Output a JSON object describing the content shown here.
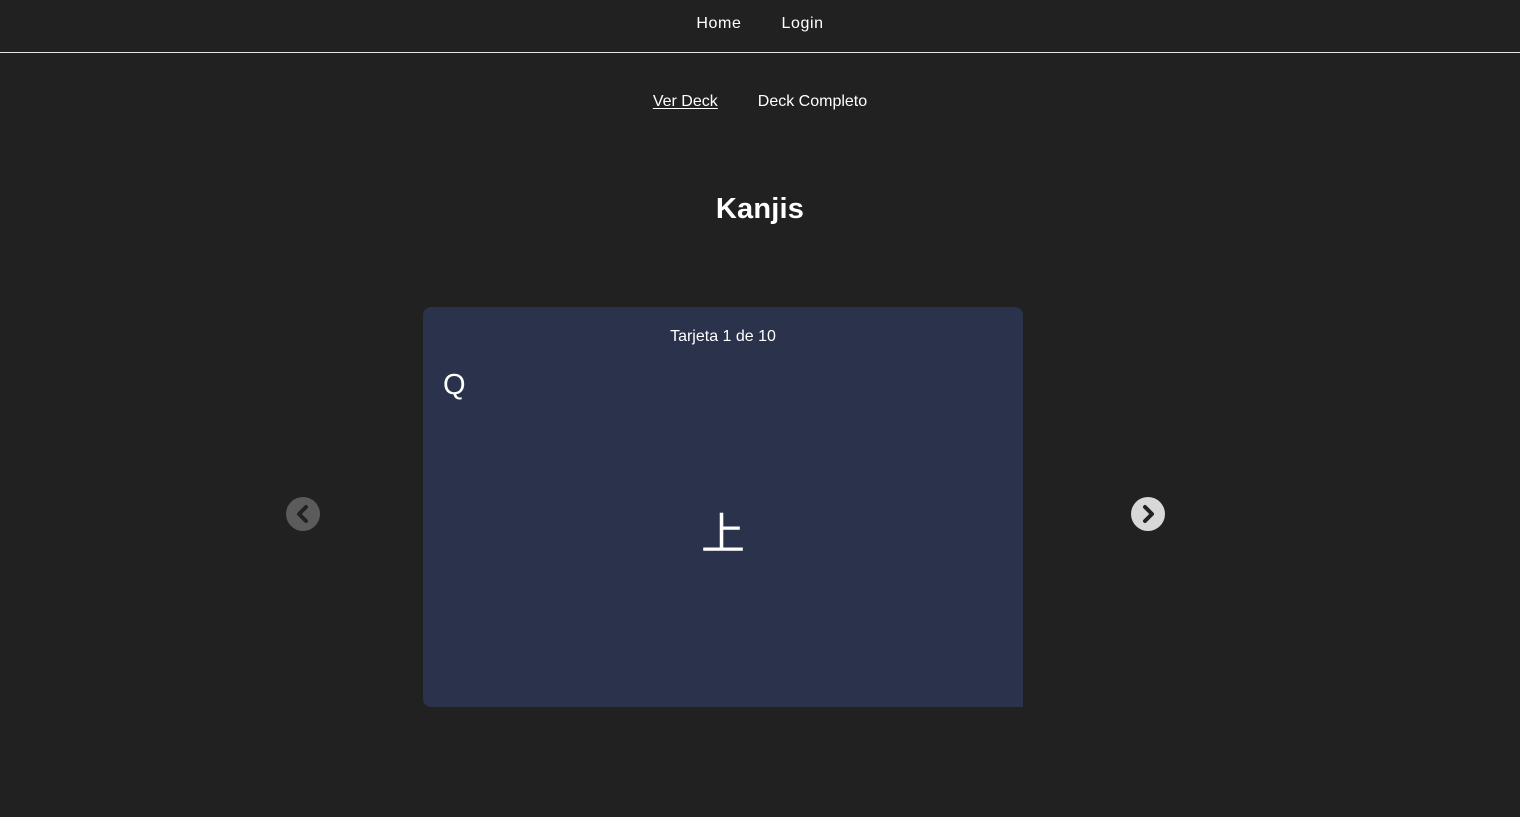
{
  "topnav": {
    "home": "Home",
    "login": "Login"
  },
  "subnav": {
    "ver_deck": "Ver Deck",
    "deck_completo": "Deck Completo"
  },
  "page": {
    "title": "Kanjis"
  },
  "card": {
    "counter": "Tarjeta 1 de 10",
    "side": "Q",
    "content": "上"
  },
  "controls": {
    "prev_icon": "chevron-left-circle-icon",
    "next_icon": "chevron-right-circle-icon"
  },
  "colors": {
    "background": "#212121",
    "card": "#2a324c",
    "prev_button": "#5b5b5b",
    "next_button": "#d8d8d8"
  }
}
